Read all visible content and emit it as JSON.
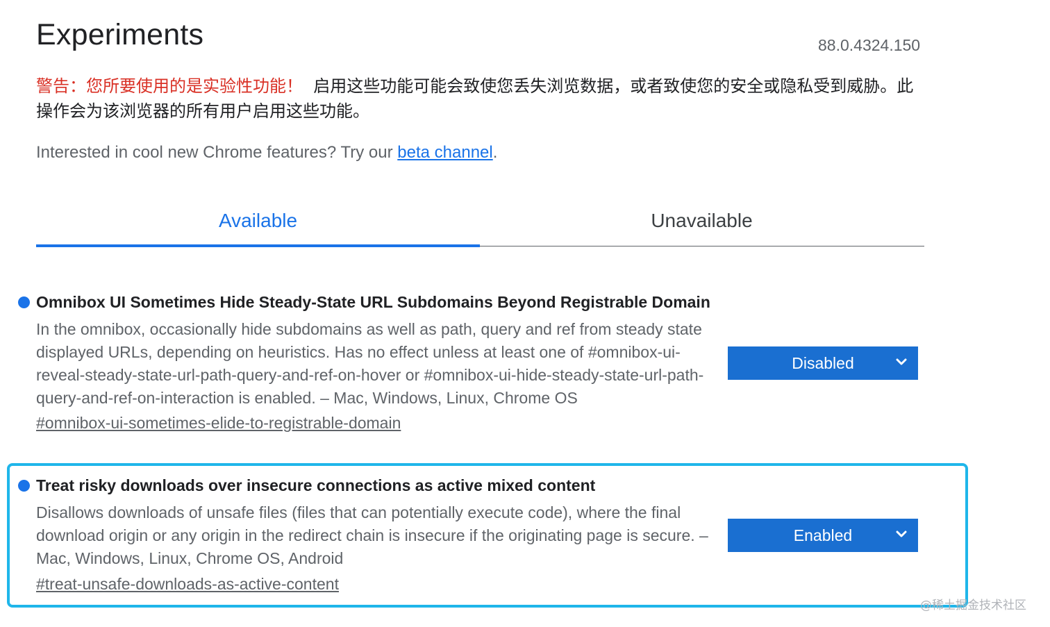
{
  "header": {
    "title": "Experiments",
    "version": "88.0.4324.150"
  },
  "warning": {
    "prefix": "警告：您所要使用的是实验性功能！",
    "text": "启用这些功能可能会致使您丢失浏览数据，或者致使您的安全或隐私受到威胁。此操作会为该浏览器的所有用户启用这些功能。"
  },
  "promo": {
    "text": "Interested in cool new Chrome features? Try our ",
    "link_label": "beta channel",
    "suffix": "."
  },
  "tabs": [
    {
      "label": "Available",
      "active": true
    },
    {
      "label": "Unavailable",
      "active": false
    }
  ],
  "experiments": [
    {
      "name": "Omnibox UI Sometimes Hide Steady-State URL Subdomains Beyond Registrable Domain",
      "description": "In the omnibox, occasionally hide subdomains as well as path, query and ref from steady state displayed URLs, depending on heuristics. Has no effect unless at least one of #omnibox-ui-reveal-steady-state-url-path-query-and-ref-on-hover or #omnibox-ui-hide-steady-state-url-path-query-and-ref-on-interaction is enabled. – Mac, Windows, Linux, Chrome OS",
      "link": "#omnibox-ui-sometimes-elide-to-registrable-domain",
      "state": "Disabled"
    },
    {
      "name": "Treat risky downloads over insecure connections as active mixed content",
      "description": "Disallows downloads of unsafe files (files that can potentially execute code), where the final download origin or any origin in the redirect chain is insecure if the originating page is secure. – Mac, Windows, Linux, Chrome OS, Android",
      "link": "#treat-unsafe-downloads-as-active-content",
      "state": "Enabled"
    }
  ],
  "watermark": "@稀土掘金技术社区",
  "colors": {
    "accent": "#1a73e8",
    "select_bg": "#1a6fd1",
    "warning_red": "#d93025",
    "highlight_border": "#1fb6ea"
  },
  "icons": {
    "feature_bullet": "blue-dot-icon",
    "select_arrow": "chevron-down-icon"
  }
}
